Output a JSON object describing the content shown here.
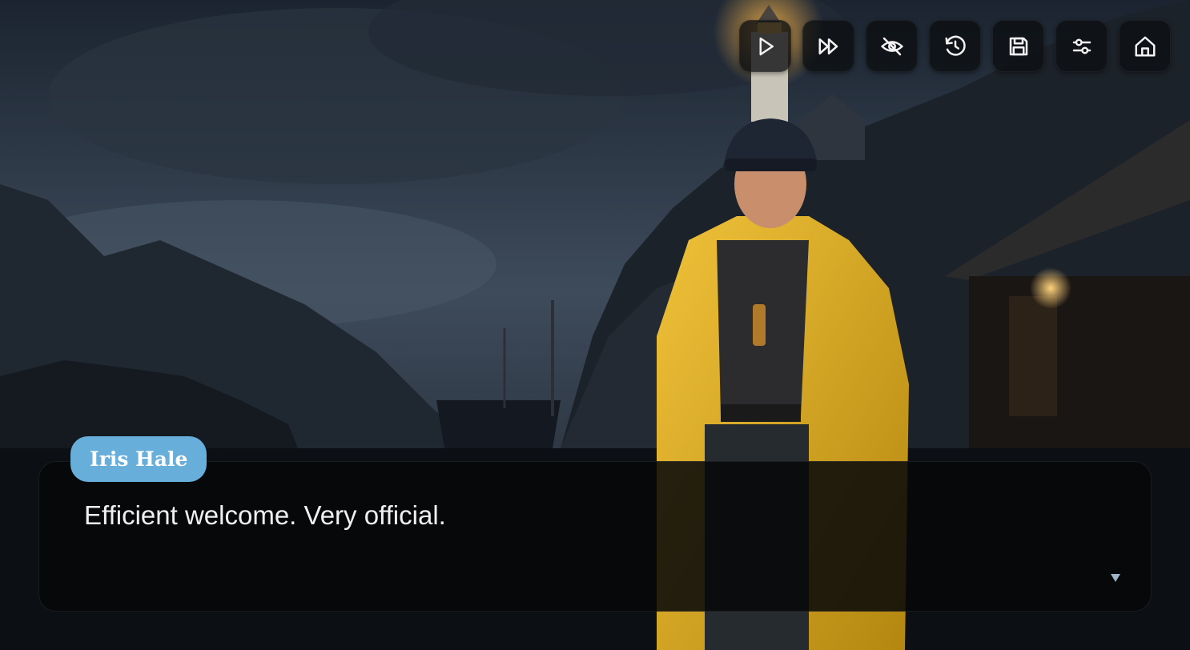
{
  "toolbar": {
    "buttons": [
      {
        "id": "auto",
        "icon": "play-icon"
      },
      {
        "id": "skip",
        "icon": "fast-forward-icon"
      },
      {
        "id": "hide-ui",
        "icon": "eye-off-icon"
      },
      {
        "id": "history",
        "icon": "history-icon"
      },
      {
        "id": "save",
        "icon": "save-icon"
      },
      {
        "id": "settings",
        "icon": "sliders-icon"
      },
      {
        "id": "home",
        "icon": "home-icon"
      }
    ]
  },
  "dialogue": {
    "speaker": "Iris Hale",
    "text": "Efficient welcome. Very official.",
    "advance_icon": "triangle-down-icon"
  },
  "colors": {
    "nameplate": "#67aedb",
    "dialogue_bg": "#060709",
    "raincoat": "#d8a820",
    "sky": "#3d4a5a"
  }
}
